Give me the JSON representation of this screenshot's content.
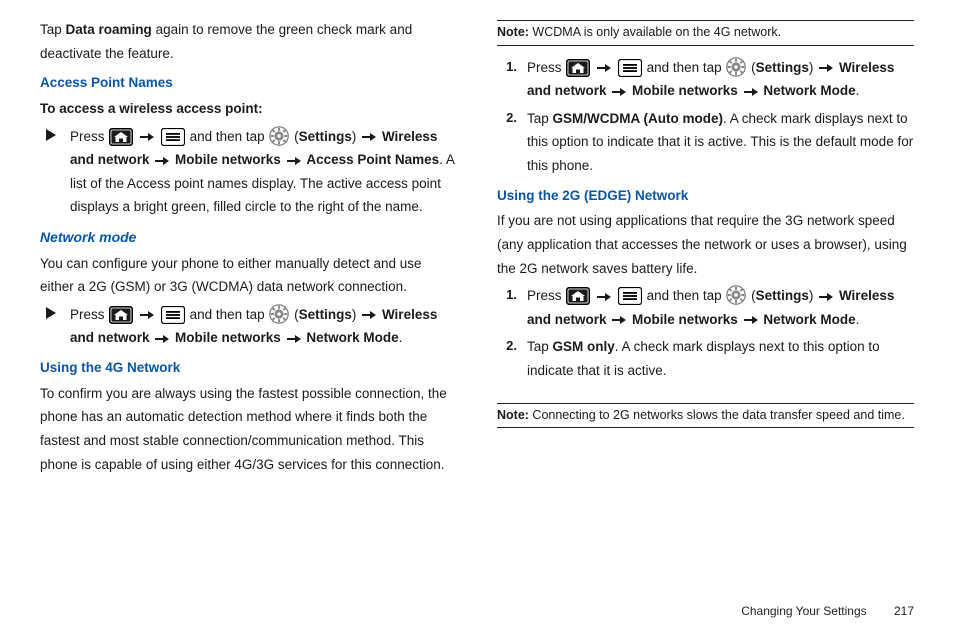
{
  "left": {
    "intro_line1a": "Tap ",
    "intro_line1b": "Data roaming",
    "intro_line1c": " again to remove the green check mark and deactivate the feature.",
    "heading_apn": "Access Point Names",
    "apn_sub": "To access a wireless access point:",
    "press_text": "Press ",
    "then_tap_text": " and then tap ",
    "settings_label": " (Settings) ",
    "path_wireless": "Wireless and network",
    "path_mobile": "Mobile networks",
    "path_apn": "Access Point Names",
    "apn_tail": ". A list of the Access point names display. The active access point displays a bright green, filled circle to the right of the name.",
    "heading_netmode": "Network mode",
    "netmode_intro": "You can configure your phone to either manually detect and use either a 2G (GSM) or 3G (WCDMA) data network connection.",
    "path_mode": "Network Mode",
    "heading_4g": "Using the 4G Network",
    "para_4g": "To confirm you are always using the fastest possible connection, the phone has an automatic detection method where it finds both the fastest and most stable connection/communication method. This phone is capable of using either 4G/3G services for this connection."
  },
  "right": {
    "note1_label": "Note:",
    "note1_body": " WCDMA is only available on the 4G network.",
    "step2a": "Tap ",
    "step2b": "GSM/WCDMA (Auto mode)",
    "step2c": ". A check mark displays next to this option to indicate that it is active. This is the default mode for this phone.",
    "heading_2g": "Using the 2G (EDGE) Network",
    "para_2g": "If you are not using applications that require the 3G network speed (any application that accesses the network or uses a browser), using the 2G network saves battery life.",
    "stepG2a": "Tap ",
    "stepG2b": "GSM only",
    "stepG2c": ". A check mark displays next to this option to indicate that it is active.",
    "note2_label": "Note:",
    "note2_body": " Connecting to 2G networks slows the data transfer speed and time."
  },
  "shared": {
    "arrow": "➔",
    "marker_tri": "▶",
    "step1": "1.",
    "step2": "2."
  },
  "footer": {
    "section": "Changing Your Settings",
    "page": "217"
  }
}
